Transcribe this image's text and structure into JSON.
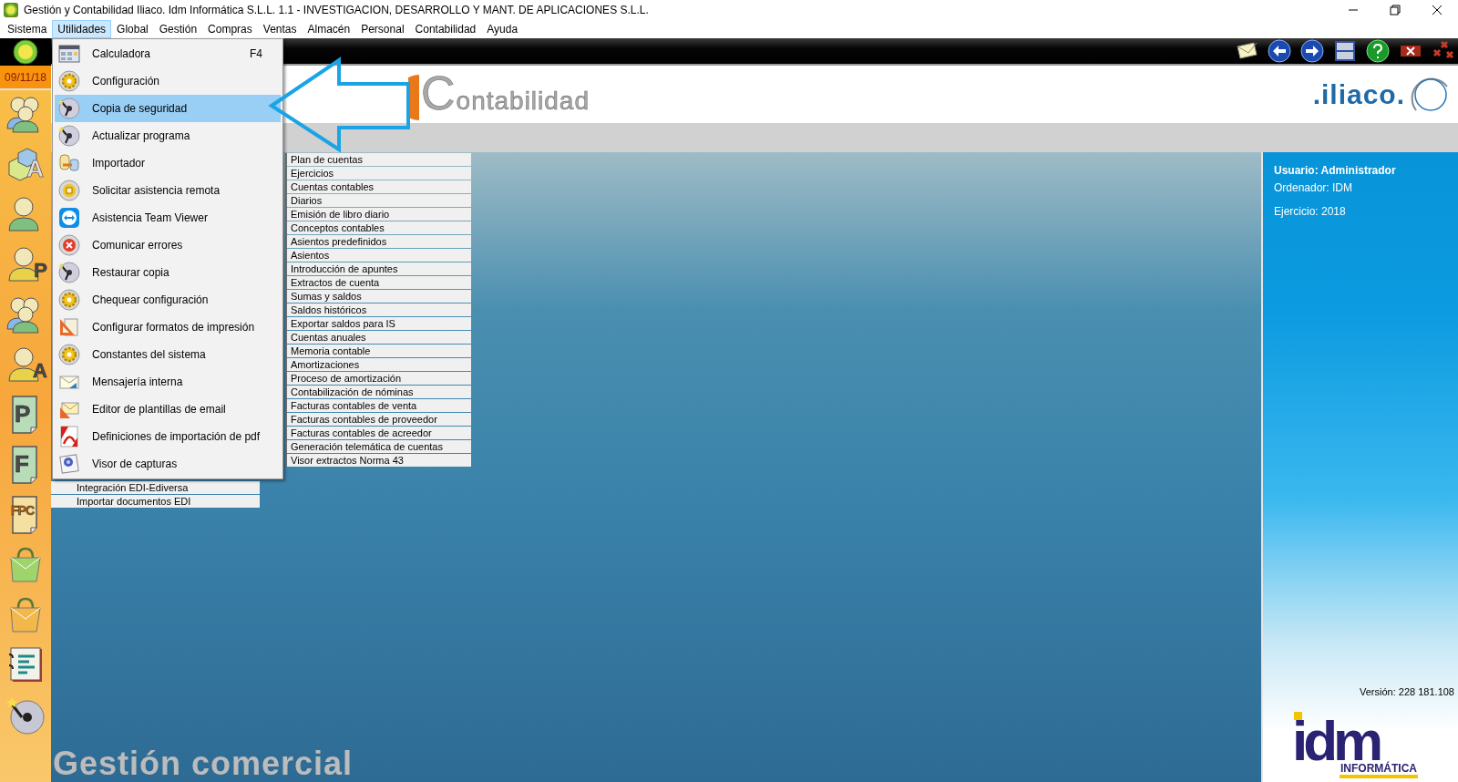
{
  "window": {
    "title": "Gestión y Contabilidad Iliaco. Idm Informática S.L.L. 1.1 - INVESTIGACION, DESARROLLO Y MANT. DE APLICACIONES S.L.L."
  },
  "menubar": [
    {
      "label": "Sistema",
      "selected": false
    },
    {
      "label": "Utilidades",
      "selected": true
    },
    {
      "label": "Global",
      "selected": false
    },
    {
      "label": "Gestión",
      "selected": false
    },
    {
      "label": "Compras",
      "selected": false
    },
    {
      "label": "Ventas",
      "selected": false
    },
    {
      "label": "Almacén",
      "selected": false
    },
    {
      "label": "Personal",
      "selected": false
    },
    {
      "label": "Contabilidad",
      "selected": false
    },
    {
      "label": "Ayuda",
      "selected": false
    }
  ],
  "dropdown": [
    {
      "label": "Calculadora",
      "shortcut": "F4",
      "selected": false
    },
    {
      "label": "Configuración",
      "selected": false
    },
    {
      "label": "Copia de seguridad",
      "selected": true
    },
    {
      "label": "Actualizar programa",
      "selected": false
    },
    {
      "label": "Importador",
      "selected": false
    },
    {
      "label": "Solicitar asistencia remota",
      "selected": false
    },
    {
      "label": "Asistencia Team Viewer",
      "selected": false
    },
    {
      "label": "Comunicar errores",
      "selected": false
    },
    {
      "label": "Restaurar copia",
      "selected": false
    },
    {
      "label": "Chequear configuración",
      "selected": false
    },
    {
      "label": "Configurar formatos de impresión",
      "selected": false
    },
    {
      "label": "Constantes del sistema",
      "selected": false
    },
    {
      "label": "Mensajería interna",
      "selected": false
    },
    {
      "label": "Editor de plantillas de email",
      "selected": false
    },
    {
      "label": "Definiciones de importación de pdf",
      "selected": false
    },
    {
      "label": "Visor de capturas",
      "selected": false
    }
  ],
  "sidebar": {
    "date": "09/11/18",
    "badges": [
      "A",
      "P",
      "A",
      "P",
      "F",
      "FPC"
    ]
  },
  "header": {
    "module_logo": "Contabilidad",
    "brand": ".iliaco."
  },
  "edi_list": [
    "Integración EDI-Ediversa",
    "Importar documentos EDI"
  ],
  "accounting_list": [
    "Plan de cuentas",
    "Ejercicios",
    "Cuentas contables",
    "Diarios",
    "Emisión de libro diario",
    "Conceptos contables",
    "Asientos predefinidos",
    "Asientos",
    "Introducción de apuntes",
    "Extractos de cuenta",
    "Sumas y saldos",
    "Saldos históricos",
    "Exportar saldos para IS",
    "Cuentas anuales",
    "Memoria contable",
    "Amortizaciones",
    "Proceso de amortización",
    "Contabilización de nóminas",
    "Facturas contables de venta",
    "Facturas contables de proveedor",
    "Facturas contables de acreedor",
    "Generación telemática de cuentas",
    "Visor extractos Norma 43"
  ],
  "module_title": "Gestión comercial",
  "info_panel": {
    "user": "Usuario: Administrador",
    "computer": "Ordenador: IDM",
    "year": "Ejercicio: 2018",
    "version": "Versión: 228 181.108",
    "logo_mark": "idm",
    "logo_caption": "INFORMÁTICA"
  }
}
